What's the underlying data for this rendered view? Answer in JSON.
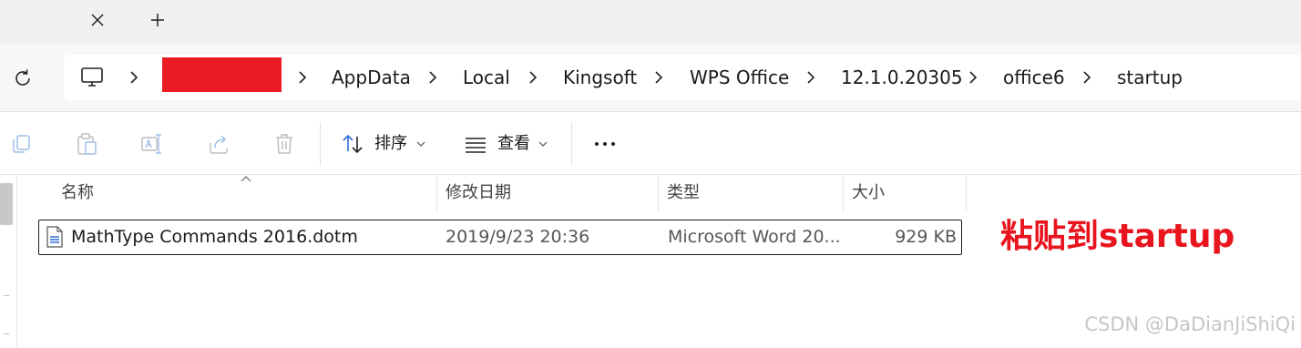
{
  "tabstrip": {
    "close_icon": "close-icon",
    "new_tab_icon": "plus-icon"
  },
  "address": {
    "refresh_icon": "refresh-icon",
    "computer_icon": "computer-icon",
    "redacted_color": "#ec1c24",
    "crumbs": [
      "AppData",
      "Local",
      "Kingsoft",
      "WPS Office",
      "12.1.0.20305",
      "office6",
      "startup"
    ]
  },
  "commands": {
    "sort_label": "排序",
    "view_label": "查看",
    "more_icon": "more-icon"
  },
  "columns": [
    "名称",
    "修改日期",
    "类型",
    "大小"
  ],
  "file": {
    "name": "MathType Commands 2016.dotm",
    "modified": "2019/9/23 20:36",
    "type": "Microsoft Word 20...",
    "size": "929 KB"
  },
  "annotation": "粘贴到startup",
  "watermark": "CSDN @DaDianJiShiQi",
  "colors": {
    "annotation": "#e8141e",
    "accent": "#2f6fd6"
  }
}
